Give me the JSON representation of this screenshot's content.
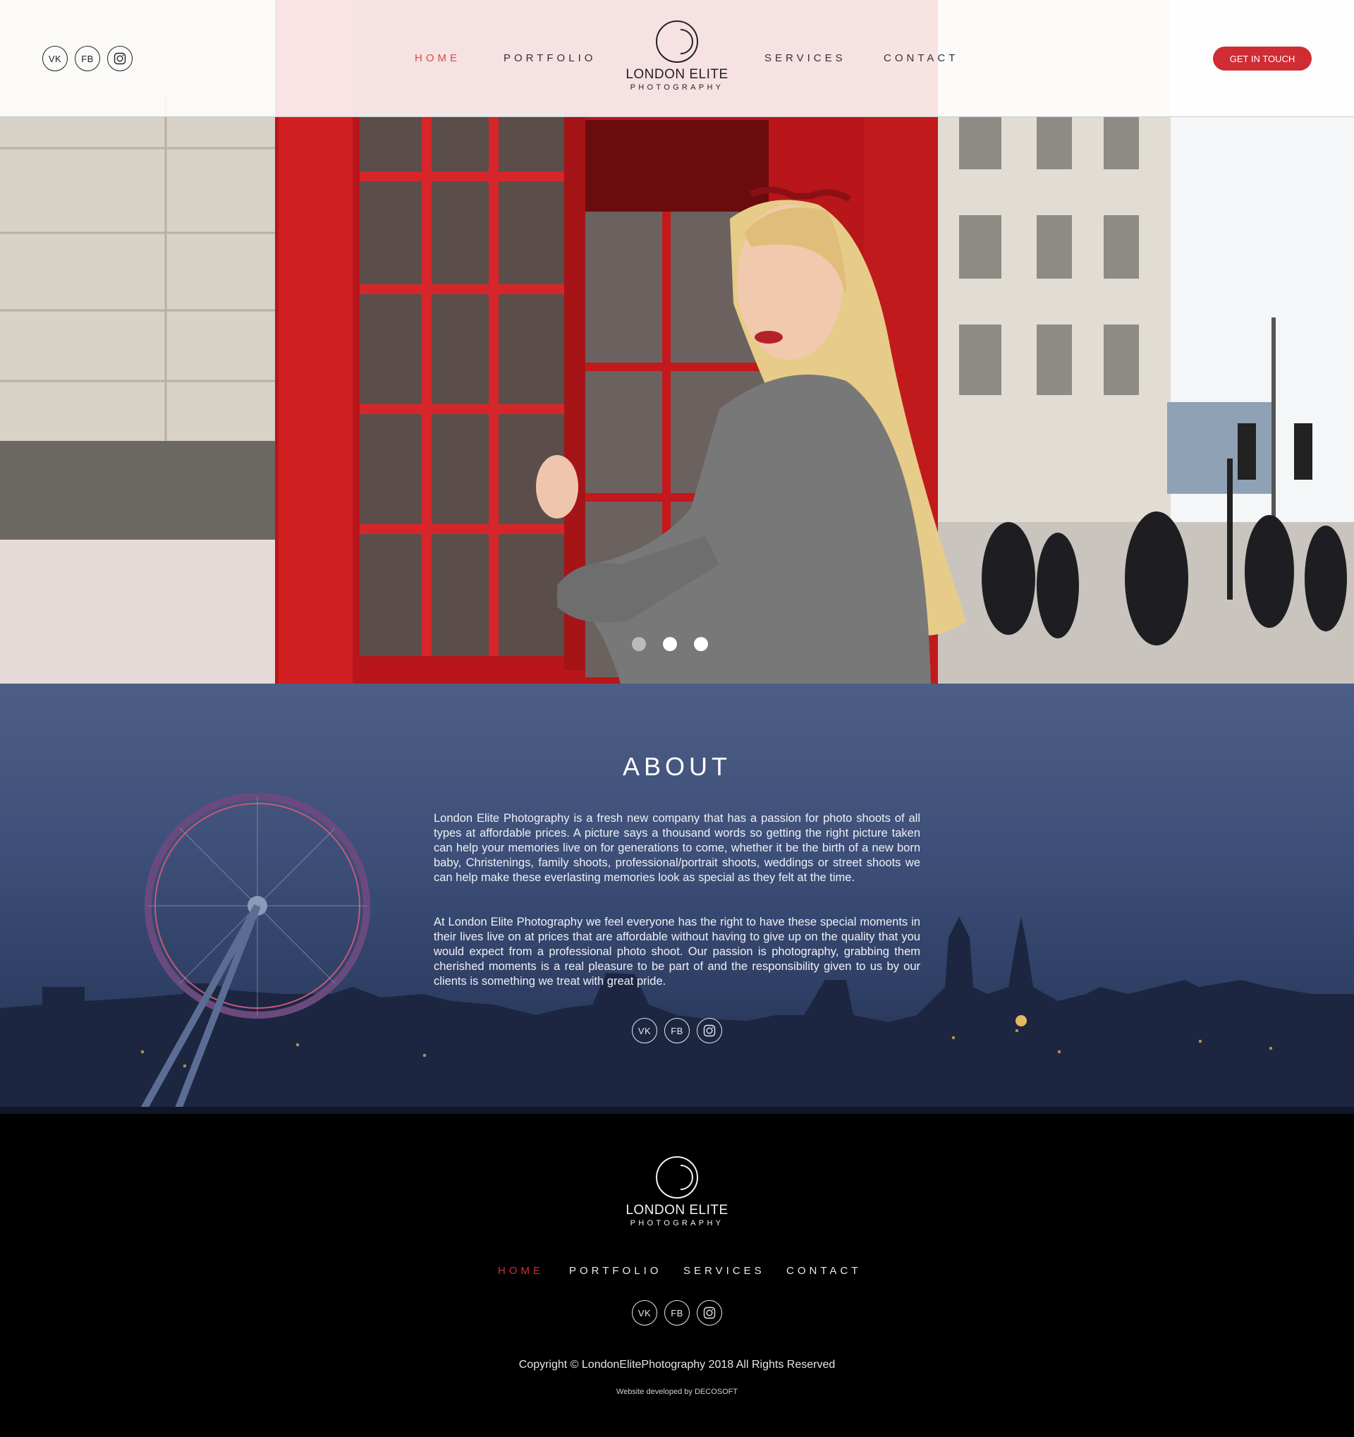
{
  "brand": {
    "name": "LONDON ELITE",
    "tagline": "PHOTOGRAPHY"
  },
  "social": [
    {
      "label": "VK",
      "icon": "vk-icon"
    },
    {
      "label": "FB",
      "icon": "facebook-icon"
    },
    {
      "icon": "instagram-icon"
    }
  ],
  "header": {
    "nav": [
      "HOME",
      "PORTFOLIO",
      "SERVICES",
      "CONTACT"
    ],
    "active": "HOME",
    "cta_label": "GET IN TOUCH"
  },
  "hero": {
    "slides_total": 3,
    "current_slide": 1
  },
  "about": {
    "title": "ABOUT",
    "paragraphs": [
      "London Elite Photography is a fresh new company that has a passion for photo shoots of all types at affordable prices. A picture says a thousand words so getting the right picture taken can help your memories live on for generations to come, whether it be the birth of a new born baby, Christenings, family shoots, professional/portrait shoots, weddings or street shoots we can help make these everlasting memories look as special as they felt at the time.",
      "At London Elite Photography we feel everyone has the right to have these special moments in their lives live on at prices that are affordable without having to give up on the quality that you would expect from a professional photo shoot. Our passion is photography, grabbing them cherished moments is a real pleasure to be part of and the responsibility given to us by our clients is something we treat with great pride."
    ]
  },
  "footer": {
    "nav": [
      "HOME",
      "PORTFOLIO",
      "SERVICES",
      "CONTACT"
    ],
    "active": "HOME",
    "copyright": "Copyright © LondonElitePhotography 2018 All Rights Reserved",
    "developed_by": "Website developed by DECOSOFT"
  },
  "colors": {
    "accent": "#d02c34",
    "nav_active": "#d84a4a",
    "footer_bg": "#000000",
    "about_bg": "#3d4f78"
  }
}
